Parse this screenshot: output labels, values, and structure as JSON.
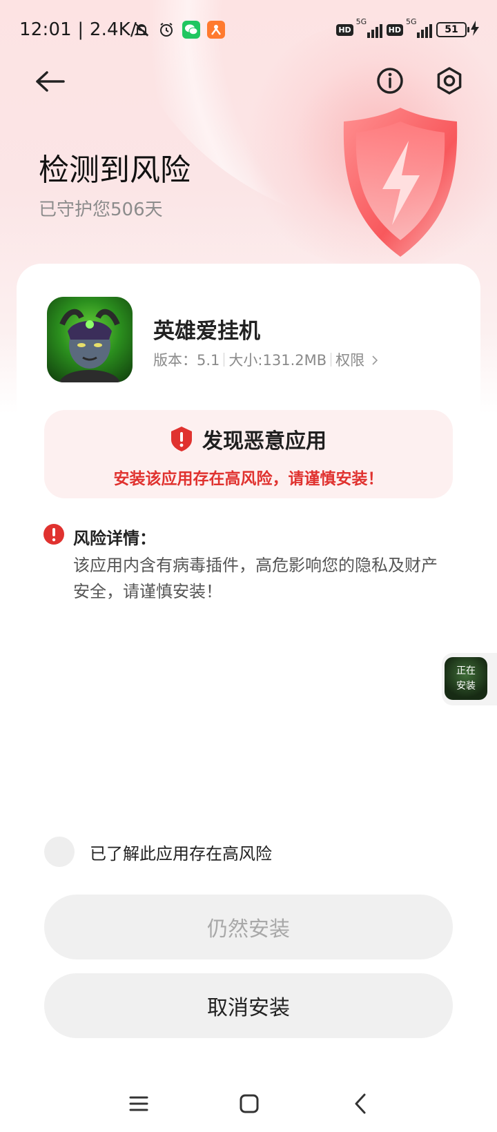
{
  "status_bar": {
    "time": "12:01",
    "speed": "2.4K/s",
    "network_1": "5G",
    "network_2": "5G",
    "hd": "HD",
    "battery": "51"
  },
  "header": {
    "title": "检测到风险",
    "subtitle": "已守护您506天",
    "icons": {
      "back": "back-arrow-icon",
      "info": "info-icon",
      "settings": "gear-icon"
    }
  },
  "app": {
    "name": "英雄爱挂机",
    "version_label": "版本：5.1",
    "size_label": "大小:131.2MB",
    "permissions_label": "权限"
  },
  "warning": {
    "title": "发现恶意应用",
    "message": "安装该应用存在高风险，请谨慎安装！"
  },
  "risk": {
    "title": "风险详情：",
    "description": "该应用内含有病毒插件，高危影响您的隐私及财产安全，请谨慎安装！"
  },
  "floating": {
    "line1": "正在",
    "line2": "安装"
  },
  "acknowledge": {
    "label": "已了解此应用存在高风险",
    "checked": false
  },
  "buttons": {
    "install": "仍然安装",
    "cancel": "取消安装"
  },
  "colors": {
    "danger": "#e0322f",
    "warning_bg": "#fdf0f0",
    "button_bg": "#f0f0f0"
  }
}
